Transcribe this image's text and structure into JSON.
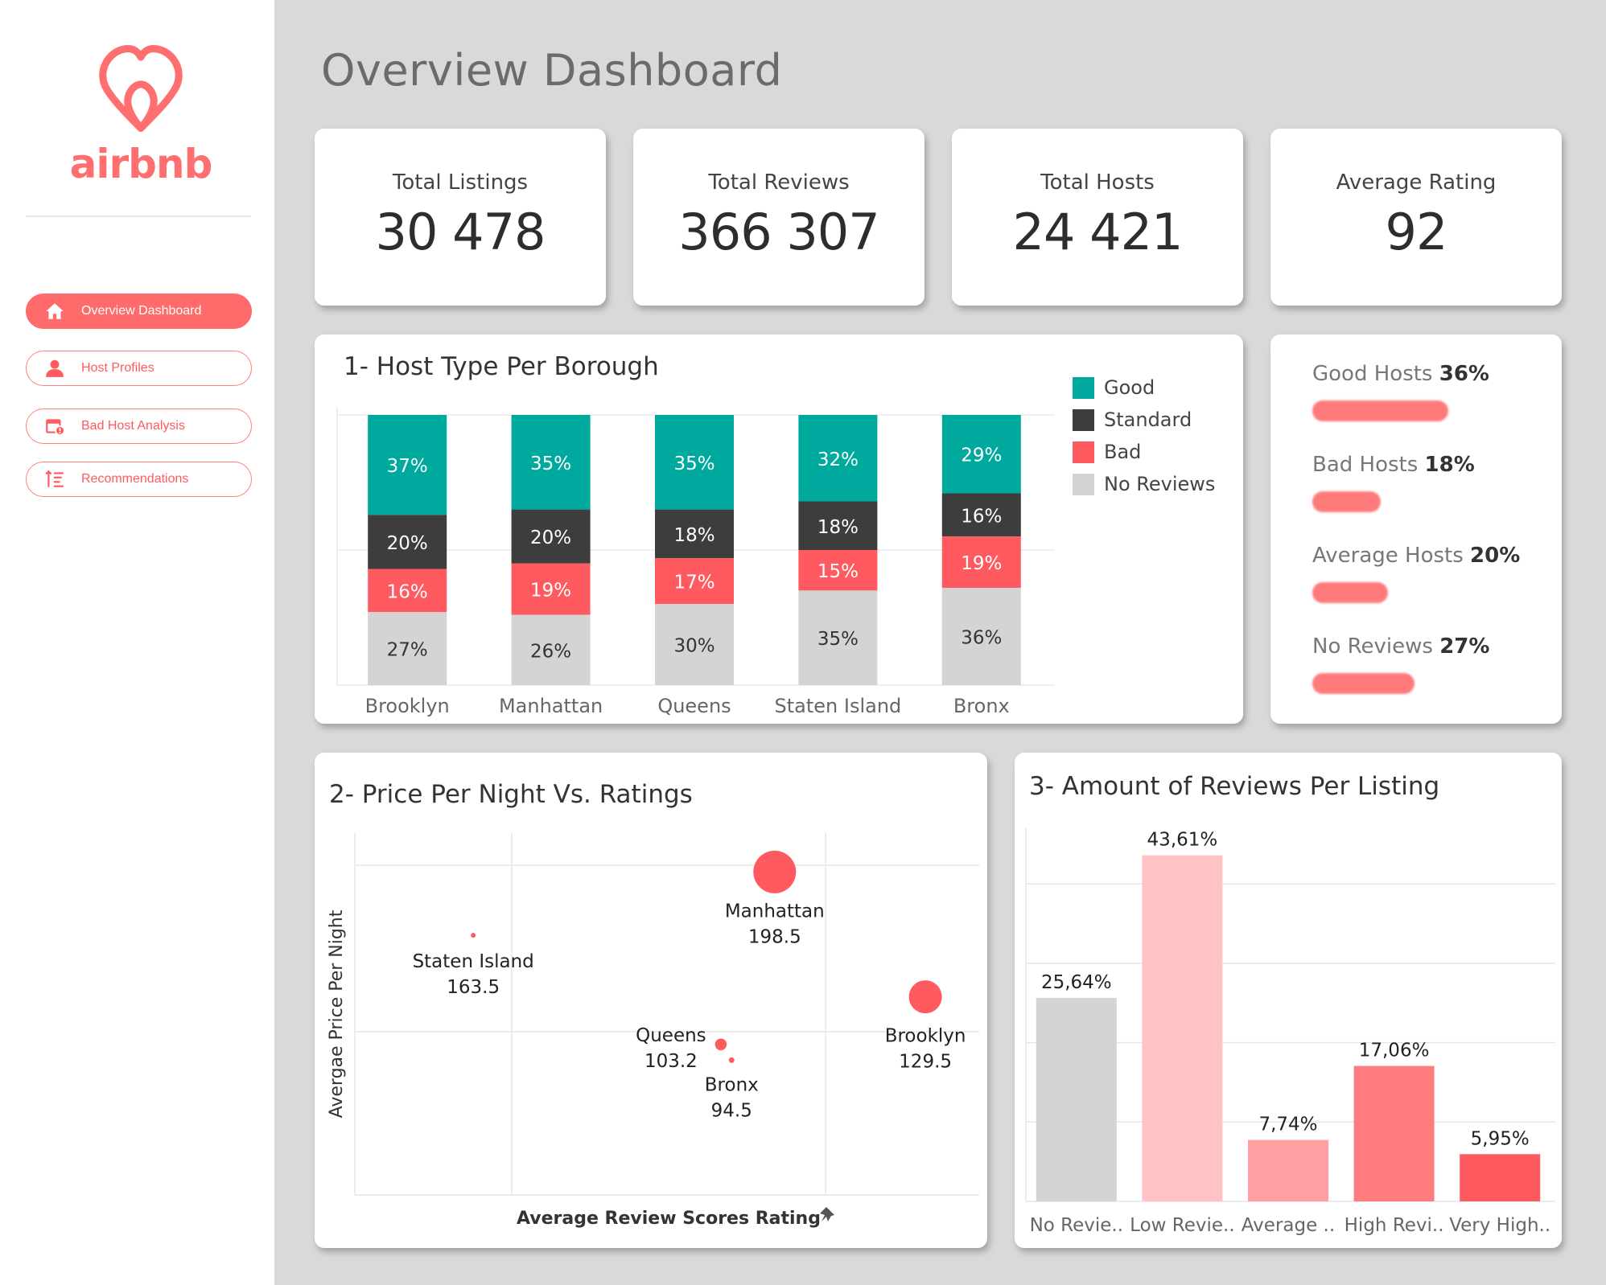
{
  "brand": {
    "name": "airbnb",
    "color": "#ff5a5f"
  },
  "nav": {
    "items": [
      {
        "label": "Overview Dashboard",
        "icon": "home-icon",
        "active": true
      },
      {
        "label": "Host Profiles",
        "icon": "user-icon",
        "active": false
      },
      {
        "label": "Bad Host Analysis",
        "icon": "calendar-alert-icon",
        "active": false
      },
      {
        "label": "Recommendations",
        "icon": "sort-list-icon",
        "active": false
      }
    ]
  },
  "page": {
    "title": "Overview Dashboard"
  },
  "kpis": [
    {
      "label": "Total Listings",
      "value": "30 478"
    },
    {
      "label": "Total Reviews",
      "value": "366 307"
    },
    {
      "label": "Total Hosts",
      "value": "24 421"
    },
    {
      "label": "Average Rating",
      "value": "92"
    }
  ],
  "host_summary": [
    {
      "label": "Good Hosts",
      "value": "36%",
      "fraction": 0.36
    },
    {
      "label": "Bad Hosts",
      "value": "18%",
      "fraction": 0.18
    },
    {
      "label": "Average Hosts",
      "value": "20%",
      "fraction": 0.2
    },
    {
      "label": "No Reviews",
      "value": "27%",
      "fraction": 0.27
    }
  ],
  "colors": {
    "good": "#00a99d",
    "standard": "#3d3d3d",
    "bad": "#ff5a5f",
    "no_reviews": "#d4d4d4"
  },
  "chart_data": [
    {
      "type": "bar",
      "stacked": true,
      "title": "1- Host Type Per Borough",
      "categories": [
        "Brooklyn",
        "Manhattan",
        "Queens",
        "Staten Island",
        "Bronx"
      ],
      "series": [
        {
          "name": "Good",
          "values": [
            37,
            35,
            35,
            32,
            29
          ]
        },
        {
          "name": "Standard",
          "values": [
            20,
            20,
            18,
            18,
            16
          ]
        },
        {
          "name": "Bad",
          "values": [
            16,
            19,
            17,
            15,
            19
          ]
        },
        {
          "name": "No Reviews",
          "values": [
            27,
            26,
            30,
            35,
            36
          ]
        }
      ],
      "labels": {
        "Good": [
          "37%",
          "35%",
          "35%",
          "32%",
          "29%"
        ],
        "Standard": [
          "20%",
          "20%",
          "18%",
          "18%",
          "16%"
        ],
        "Bad": [
          "16%",
          "19%",
          "17%",
          "15%",
          "19%"
        ],
        "No Reviews": [
          "27%",
          "26%",
          "30%",
          "35%",
          "36%"
        ]
      },
      "legend": "right",
      "grid": true
    },
    {
      "type": "scatter",
      "title": "2- Price Per Night Vs. Ratings",
      "xlabel": "Average Review Scores Rating",
      "ylabel": "Avergae Price Per Night",
      "points": [
        {
          "name": "Staten Island",
          "x": 90.6,
          "y": 163.5,
          "label": "163.5",
          "size": 0.02
        },
        {
          "name": "Manhattan",
          "x": 93.4,
          "y": 198.5,
          "label": "198.5",
          "size": 1.0
        },
        {
          "name": "Queens",
          "x": 92.9,
          "y": 103.2,
          "label": "103.2",
          "size": 0.2
        },
        {
          "name": "Bronx",
          "x": 93.0,
          "y": 94.5,
          "label": "94.5",
          "size": 0.04
        },
        {
          "name": "Brooklyn",
          "x": 94.8,
          "y": 129.5,
          "label": "129.5",
          "size": 0.75
        }
      ],
      "xlim": [
        89.5,
        95.3
      ],
      "ylim": [
        20,
        220
      ],
      "grid": true
    },
    {
      "type": "bar",
      "title": "3- Amount of Reviews Per Listing",
      "categories": [
        "No Revie..",
        "Low Revie..",
        "Average ..",
        "High Revi..",
        "Very High.."
      ],
      "values": [
        25.64,
        43.61,
        7.74,
        17.06,
        5.95
      ],
      "value_labels": [
        "25,64%",
        "43,61%",
        "7,74%",
        "17,06%",
        "5,95%"
      ],
      "colors": [
        "#d4d4d4",
        "#ffc2c5",
        "#ff9fa2",
        "#ff7b7e",
        "#ff5a5f"
      ],
      "ylim": [
        0,
        46
      ],
      "grid": true
    }
  ]
}
